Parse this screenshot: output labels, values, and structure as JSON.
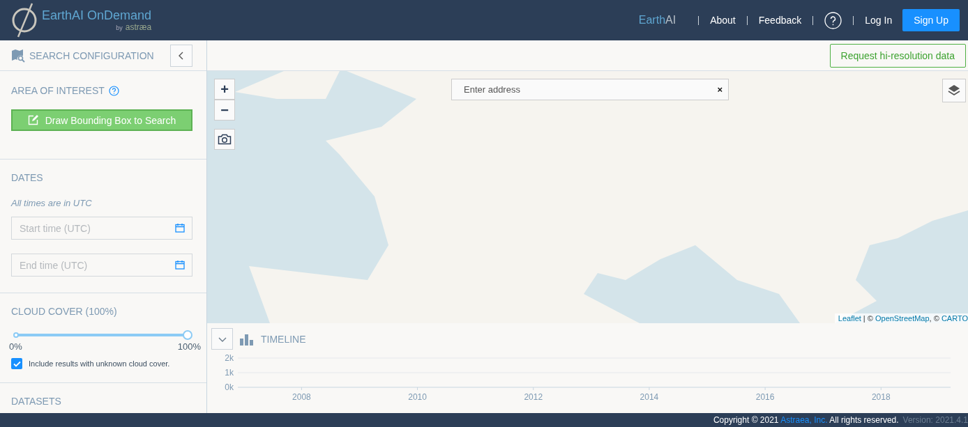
{
  "header": {
    "logo_title": "EarthAI OnDemand",
    "logo_by": "by",
    "logo_company": "astræa",
    "brand": [
      "Earth",
      "AI"
    ],
    "nav": [
      {
        "kind": "link",
        "label": "About"
      },
      {
        "kind": "link",
        "label": "Feedback"
      },
      {
        "kind": "help"
      },
      {
        "kind": "link",
        "label": "Log In"
      }
    ],
    "signup": "Sign Up"
  },
  "sidebar": {
    "title": "SEARCH CONFIGURATION",
    "area_of_interest": {
      "title": "AREA OF INTEREST",
      "button": "Draw Bounding Box to Search"
    },
    "dates": {
      "title": "DATES",
      "note": "All times are in UTC",
      "fields": [
        {
          "placeholder": "Start time (UTC)"
        },
        {
          "placeholder": "End time (UTC)"
        }
      ]
    },
    "cloud_cover": {
      "title": "CLOUD COVER (100%)",
      "level": 1,
      "min_label": "0%",
      "max_label": "100%",
      "checkbox": {
        "label": "Include results with unknown cloud cover.",
        "checked": true
      }
    },
    "datasets": {
      "title": "DATASETS"
    }
  },
  "toolbar": {
    "request_button": "Request hi-resolution data"
  },
  "map": {
    "search": {
      "placeholder": "Enter address",
      "clear": "×"
    },
    "zoom_in": "+",
    "zoom_out": "−",
    "attribution": [
      {
        "kind": "link",
        "text": "Leaflet"
      },
      {
        "kind": "text",
        "text": " | © "
      },
      {
        "kind": "link",
        "text": "OpenStreetMap"
      },
      {
        "kind": "text",
        "text": ", © "
      },
      {
        "kind": "link",
        "text": "CARTO"
      }
    ]
  },
  "timeline": {
    "title": "TIMELINE",
    "chart_data": {
      "type": "bar",
      "xlim": [
        2006.9,
        2019.2
      ],
      "ylim": [
        0,
        2000
      ],
      "xticks": [
        2008,
        2010,
        2012,
        2014,
        2016,
        2018
      ],
      "yticks": [
        {
          "value": 0,
          "label": "0k"
        },
        {
          "value": 1000,
          "label": "1k"
        },
        {
          "value": 2000,
          "label": "2k"
        }
      ]
    }
  },
  "footer": {
    "copyright": "Copyright © 2021 ",
    "company": "Astraea, Inc.",
    "rights": " All rights reserved.",
    "version": "Version: 2021.4.1"
  }
}
